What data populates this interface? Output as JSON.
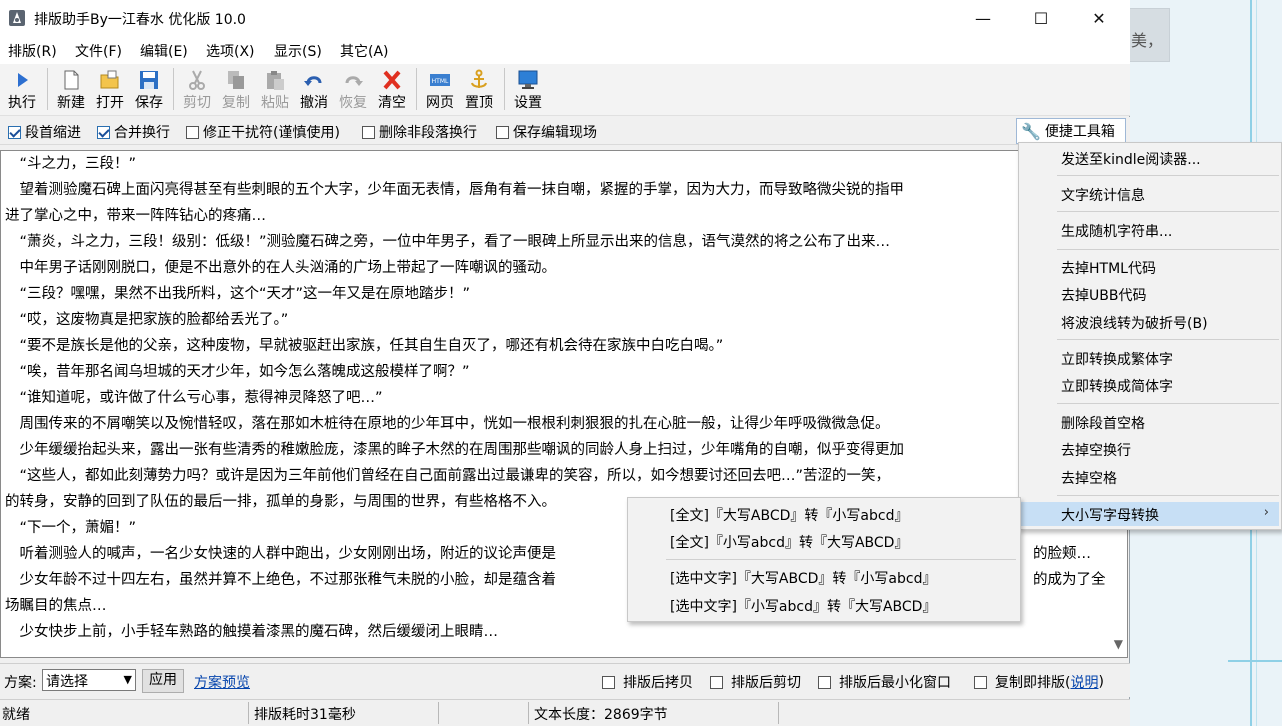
{
  "window": {
    "title": "排版助手By一江春水 优化版 10.0",
    "minimize": "—",
    "maximize": "☐",
    "close": "✕"
  },
  "menubar": [
    "排版(R)",
    "文件(F)",
    "编辑(E)",
    "选项(X)",
    "显示(S)",
    "其它(A)"
  ],
  "toolbar": {
    "execute": "执行",
    "new": "新建",
    "open": "打开",
    "save": "保存",
    "cut": "剪切",
    "copy": "复制",
    "paste": "粘贴",
    "undo": "撤消",
    "redo": "恢复",
    "clear": "清空",
    "web": "网页",
    "top": "置顶",
    "settings": "设置"
  },
  "options": {
    "indent": {
      "label": "段首缩进",
      "checked": true
    },
    "merge": {
      "label": "合并换行",
      "checked": true
    },
    "fix": {
      "label": "修正干扰符(谨慎使用)",
      "checked": false
    },
    "delete_non_para": {
      "label": "删除非段落换行",
      "checked": false
    },
    "save_scene": {
      "label": "保存编辑现场",
      "checked": false
    },
    "toolbox": "便捷工具箱"
  },
  "editor_lines": [
    "　“斗之力，三段！”",
    "　望着测验魔石碑上面闪亮得甚至有些刺眼的五个大字，少年面无表情，唇角有着一抹自嘲，紧握的手掌，因为大力，而导致略微尖锐的指甲",
    "进了掌心之中，带来一阵阵钻心的疼痛…",
    "　“萧炎，斗之力，三段！级别：低级！”测验魔石碑之旁，一位中年男子，看了一眼碑上所显示出来的信息，语气漠然的将之公布了出来…",
    "　中年男子话刚刚脱口，便是不出意外的在人头汹涌的广场上带起了一阵嘲讽的骚动。",
    "　“三段？嘿嘿，果然不出我所料，这个“天才”这一年又是在原地踏步！”",
    "　“哎，这废物真是把家族的脸都给丢光了。”",
    "　“要不是族长是他的父亲，这种废物，早就被驱赶出家族，任其自生自灭了，哪还有机会待在家族中白吃白喝。”",
    "　“唉，昔年那名闻乌坦城的天才少年，如今怎么落魄成这般模样了啊？”",
    "　“谁知道呢，或许做了什么亏心事，惹得神灵降怒了吧…”",
    "　周围传来的不屑嘲笑以及惋惜轻叹，落在那如木桩待在原地的少年耳中，恍如一根根利刺狠狠的扎在心脏一般，让得少年呼吸微微急促。",
    "　少年缓缓抬起头来，露出一张有些清秀的稚嫩脸庞，漆黑的眸子木然的在周围那些嘲讽的同龄人身上扫过，少年嘴角的自嘲，似乎变得更加",
    "　“这些人，都如此刻薄势力吗？或许是因为三年前他们曾经在自己面前露出过最谦卑的笑容，所以，如今想要讨还回去吧…”苦涩的一笑，",
    "的转身，安静的回到了队伍的最后一排，孤单的身影，与周围的世界，有些格格不入。",
    "　“下一个，萧媚！”",
    "　听着测验人的喊声，一名少女快速的人群中跑出，少女刚刚出场，附近的议论声便是",
    "　少女年龄不过十四左右，虽然并算不上绝色，不过那张稚气未脱的小脸，却是蕴含着",
    "场瞩目的焦点…",
    "　少女快步上前，小手轻车熟路的触摸着漆黑的魔石碑，然后缓缓闭上眼睛…"
  ],
  "editor_tail": {
    "line15": "的脸颊…",
    "line16": "的成为了全"
  },
  "bottombar": {
    "scheme_label": "方案:",
    "scheme_value": "请选择",
    "apply": "应用",
    "preview": "方案预览",
    "copy_after": "排版后拷贝",
    "cut_after": "排版后剪切",
    "minimize_after": "排版后最小化窗口",
    "copy_format": "复制即排版(",
    "help": "说明",
    "close_paren": ")"
  },
  "status": {
    "ready": "就绪",
    "time": "排版耗时31毫秒",
    "length": "文本长度：2869字节"
  },
  "toolbox_menu": {
    "groups": [
      [
        "发送至kindle阅读器..."
      ],
      [
        "文字统计信息"
      ],
      [
        "生成随机字符串..."
      ],
      [
        "去掉HTML代码",
        "去掉UBB代码",
        "将波浪线转为破折号(B)"
      ],
      [
        "立即转换成繁体字",
        "立即转换成简体字"
      ],
      [
        "删除段首空格",
        "去掉空换行",
        "去掉空格"
      ],
      [
        "大小写字母转换"
      ]
    ],
    "submenu_arrow": "›"
  },
  "case_submenu": [
    "[全文]『大写ABCD』转『小写abcd』",
    "[全文]『小写abcd』转『大写ABCD』",
    "[选中文字]『大写ABCD』转『小写abcd』",
    "[选中文字]『小写abcd』转『大写ABCD』"
  ],
  "background": {
    "snippet": "美，"
  },
  "colors": {
    "menu_highlight": "#c7dff5",
    "link": "#0645ad",
    "accent_line": "#8fd0e6"
  }
}
